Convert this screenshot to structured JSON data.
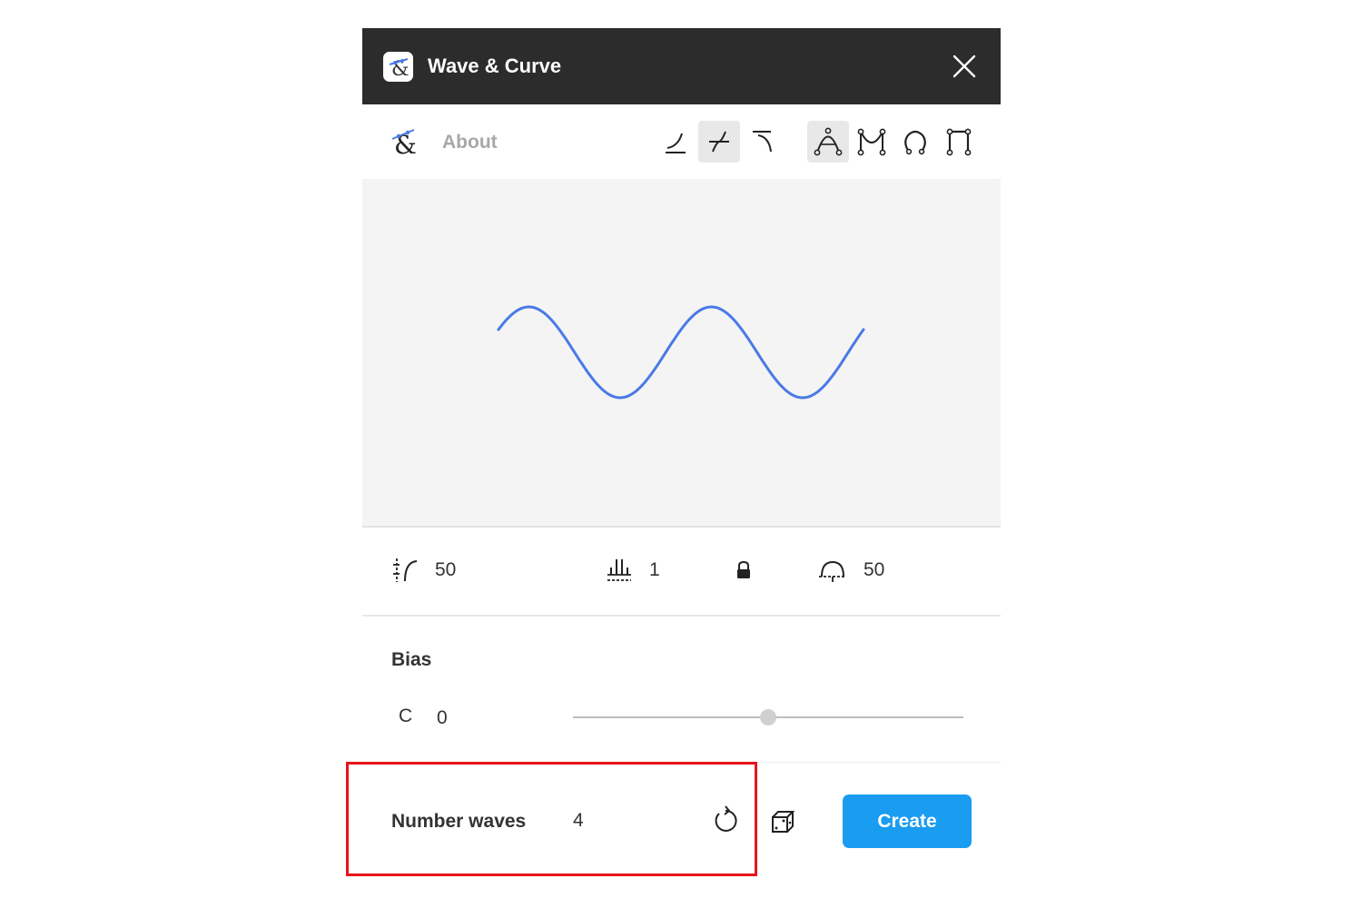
{
  "window": {
    "title": "Wave & Curve"
  },
  "toolbar": {
    "about_label": "About",
    "curve_tools": [
      "curve-down-icon",
      "wave-icon",
      "curve-up-icon"
    ],
    "shape_tools": [
      "peak-icon",
      "bezier-icon",
      "loop-icon",
      "square-wave-icon"
    ],
    "active_curve_tool": 1,
    "active_shape_tool": 0
  },
  "preview": {
    "wave_color": "#4a7ae6",
    "waves": 2
  },
  "params": {
    "amplitude": "50",
    "steps": "1",
    "lock_icon": "lock-icon",
    "radius": "50"
  },
  "bias": {
    "label": "Bias",
    "letter": "C",
    "value": "0",
    "slider_fraction": 0.5
  },
  "footer": {
    "number_waves_label": "Number waves",
    "number_waves_value": "4",
    "create_label": "Create"
  },
  "colors": {
    "accent": "#1a9cf0",
    "highlight": "#e8141b",
    "titlebar": "#2c2c2c"
  }
}
